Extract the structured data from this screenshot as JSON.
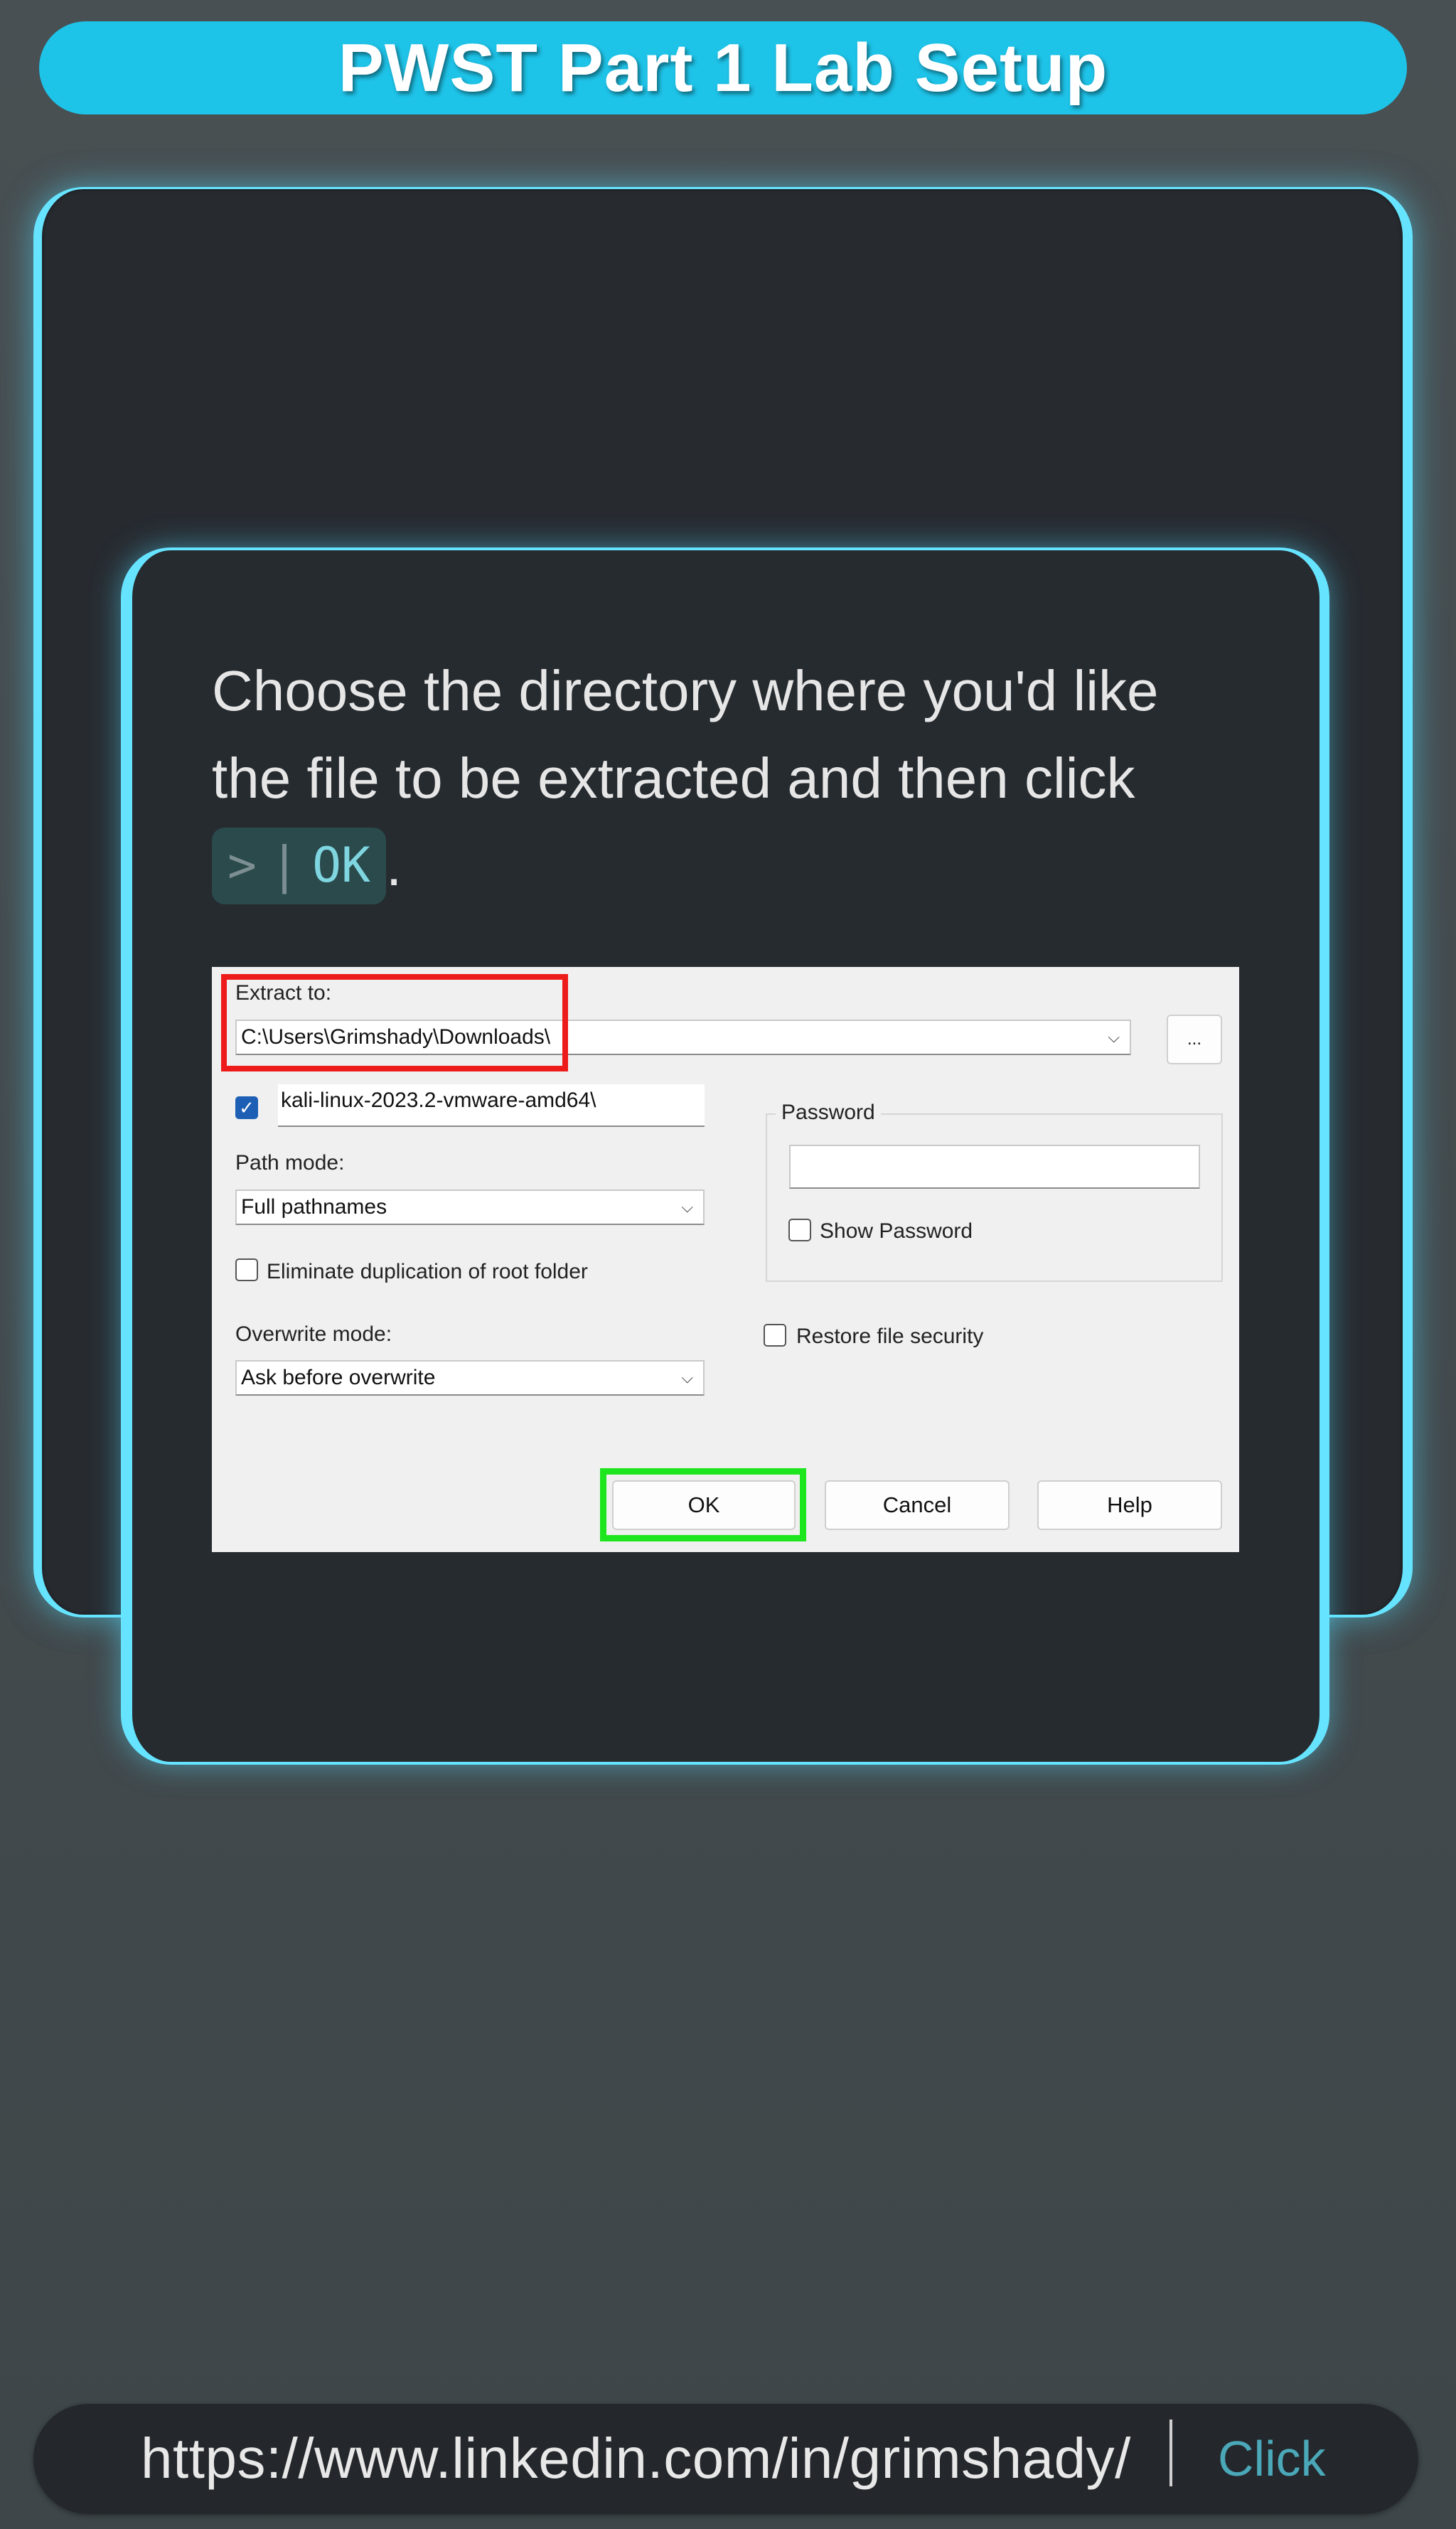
{
  "header": {
    "title": "PWST Part 1 Lab Setup"
  },
  "slide": {
    "instruction_text": "Choose the directory where you'd like the file to be extracted and then click",
    "key_prompt": ">",
    "key_label": "OK",
    "trailing_period": "."
  },
  "dialog": {
    "extract_to_label": "Extract to:",
    "extract_to_value": "C:\\Users\\Grimshady\\Downloads\\",
    "browse_label": "...",
    "subfolder_checked": true,
    "subfolder_value": "kali-linux-2023.2-vmware-amd64\\",
    "path_mode_label": "Path mode:",
    "path_mode_value": "Full pathnames",
    "eliminate_dup_label": "Eliminate duplication of root folder",
    "overwrite_mode_label": "Overwrite mode:",
    "overwrite_mode_value": "Ask before overwrite",
    "password_group_label": "Password",
    "password_value": "",
    "show_password_label": "Show Password",
    "restore_security_label": "Restore file security",
    "ok_label": "OK",
    "cancel_label": "Cancel",
    "help_label": "Help",
    "highlight_colors": {
      "extract_to": "#ee1b1b",
      "ok_button": "#1ee61e"
    }
  },
  "footer": {
    "url": "https://www.linkedin.com/in/grimshady/",
    "click_label": "Click"
  },
  "colors": {
    "accent": "#1ec3e8",
    "glow": "#66e4ff",
    "card_bg": "#272b30"
  }
}
